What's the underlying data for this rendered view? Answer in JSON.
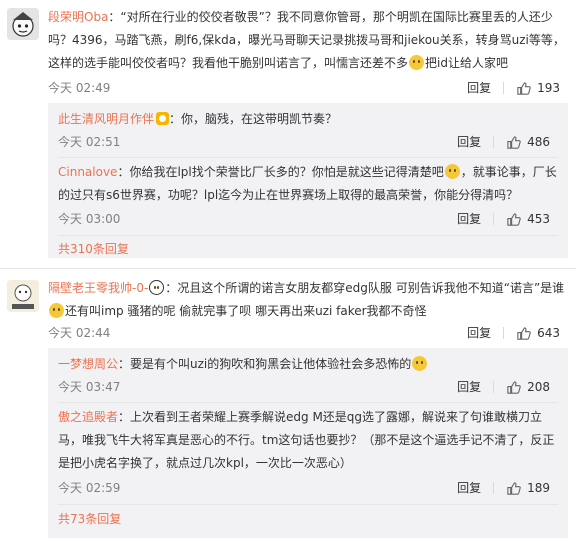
{
  "comments": [
    {
      "user": "段荣明Oba",
      "text": "：“对所在行业的佼佼者敬畏”？我不同意你管哥，那个明凯在国际比赛里丢的人还少吗？4396，马踏飞燕，刷f6,保kda，曝光马哥聊天记录挑拨马哥和jiekou关系，转身骂uzi等等，这样的选手能叫佼佼者吗？我看他干脆别叫诺言了，叫懦言还差不多",
      "text_tail": "把id让给人家吧",
      "time": "今天 02:49",
      "reply_label": "回复",
      "likes": "193",
      "replies": [
        {
          "user": "此生清风明月作伴",
          "text": "：你，脑残，在这带明凯节奏？",
          "time": "今天 02:51",
          "reply_label": "回复",
          "likes": "486"
        },
        {
          "user": "Cinnalove",
          "text": "：你给我在lpl找个荣誉比厂长多的？你怕是就这些记得清楚吧",
          "text_tail": "，就事论事，厂长的过只有s6世界赛，功呢？lpl迄今为止在世界赛场上取得的最高荣誉，你能分得清吗？",
          "time": "今天 03:00",
          "reply_label": "回复",
          "likes": "453"
        }
      ],
      "more_label": "共310条回复"
    },
    {
      "user": "隔壁老王零我帅-0-",
      "text": "：况且这个所谓的诺言女朋友都穿edg队服 可别告诉我他不知道“诺言”是谁",
      "text_line2": "还有叫imp 骚猪的呢 偷就完事了呗 哪天再出来uzi faker我都不奇怪",
      "time": "今天 02:44",
      "reply_label": "回复",
      "likes": "643",
      "replies": [
        {
          "user": "一梦想周公",
          "text": "：要是有个叫uzi的狗吹和狗黑会让他体验社会多恐怖的",
          "time": "今天 03:47",
          "reply_label": "回复",
          "likes": "208"
        },
        {
          "user": "傲之追殿者",
          "text": "：上次看到王者荣耀上赛季解说edg M还是qg选了露娜，解说来了句谁敢横刀立马，唯我飞牛大将军真是恶心的不行。tm这句话也要抄？（那不是这个逼选手记不清了，反正是把小虎名字换了，就点过几次kpl，一次比一次恶心）",
          "time": "今天 02:59",
          "reply_label": "回复",
          "likes": "189"
        }
      ],
      "more_label": "共73条回复"
    }
  ]
}
